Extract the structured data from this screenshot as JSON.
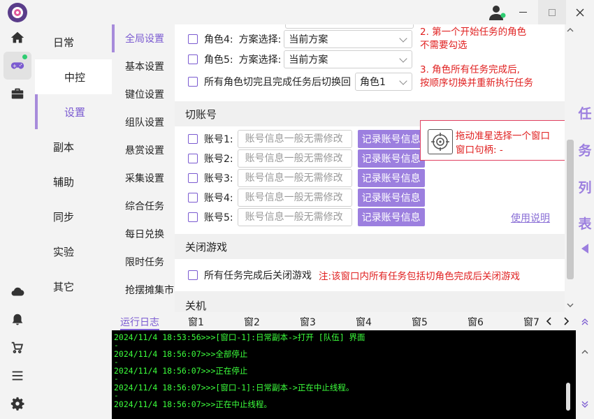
{
  "nav_primary": [
    {
      "label": "日常"
    },
    {
      "label": "中控"
    },
    {
      "label": "设置"
    },
    {
      "label": "副本"
    },
    {
      "label": "辅助"
    },
    {
      "label": "同步"
    },
    {
      "label": "实验"
    },
    {
      "label": "其它"
    }
  ],
  "nav_secondary": [
    {
      "label": "全局设置"
    },
    {
      "label": "基本设置"
    },
    {
      "label": "键位设置"
    },
    {
      "label": "组队设置"
    },
    {
      "label": "悬赏设置"
    },
    {
      "label": "采集设置"
    },
    {
      "label": "综合任务"
    },
    {
      "label": "每日兑换"
    },
    {
      "label": "限时任务"
    },
    {
      "label": "抢摆摊集市"
    }
  ],
  "roles": [
    {
      "label": "角色4:",
      "scheme_label": "方案选择:",
      "selected": "当前方案"
    },
    {
      "label": "角色5:",
      "scheme_label": "方案选择:",
      "selected": "当前方案"
    }
  ],
  "switch_all": {
    "label": "所有角色切完且完成任务后切换回",
    "selected": "角色1"
  },
  "notes": {
    "note2_line1": "2. 第一个开始任务的角色",
    "note2_line2": "不需要勾选",
    "note3_line1": "3. 角色所有任务完成后,",
    "note3_line2": "按顺序切换并重新执行任务"
  },
  "account_section": {
    "title": "切账号",
    "placeholder": "账号信息一般无需修改",
    "record_label": "记录账号信息",
    "accounts": [
      {
        "label": "账号1:"
      },
      {
        "label": "账号2:"
      },
      {
        "label": "账号3:"
      },
      {
        "label": "账号4:"
      },
      {
        "label": "账号5:"
      }
    ],
    "help_link": "使用说明"
  },
  "finder": {
    "line1": "拖动准星选择一个窗口",
    "line2": "窗口句柄:  -"
  },
  "close_section": {
    "title": "关闭游戏",
    "option": "所有任务完成后关闭游戏",
    "note": "注:该窗口内所有任务包括切角色完成后关闭游戏"
  },
  "shutdown_section": {
    "title": "关机"
  },
  "task_list_label": [
    "任",
    "务",
    "列",
    "表"
  ],
  "log_tabs": [
    "运行日志",
    "窗1",
    "窗2",
    "窗3",
    "窗4",
    "窗5",
    "窗6",
    "窗7"
  ],
  "log_lines": [
    "2024/11/4 18:53:56>>>[窗口-1]:日常副本->打开 [队伍] 界面",
    "2024/11/4 18:56:07>>>全部停止",
    "2024/11/4 18:56:07>>>正在停止",
    "2024/11/4 18:56:07>>>[窗口-1]:日常副本->正在中止线程。",
    "2024/11/4 18:56:07>>>正在中止线程。"
  ],
  "log_dash": "-",
  "colors": {
    "accent": "#7b5bd1",
    "button": "#9c7fdf",
    "note_red": "#e02020",
    "log_green": "#3cff3c",
    "online_green": "#2ecc71"
  }
}
